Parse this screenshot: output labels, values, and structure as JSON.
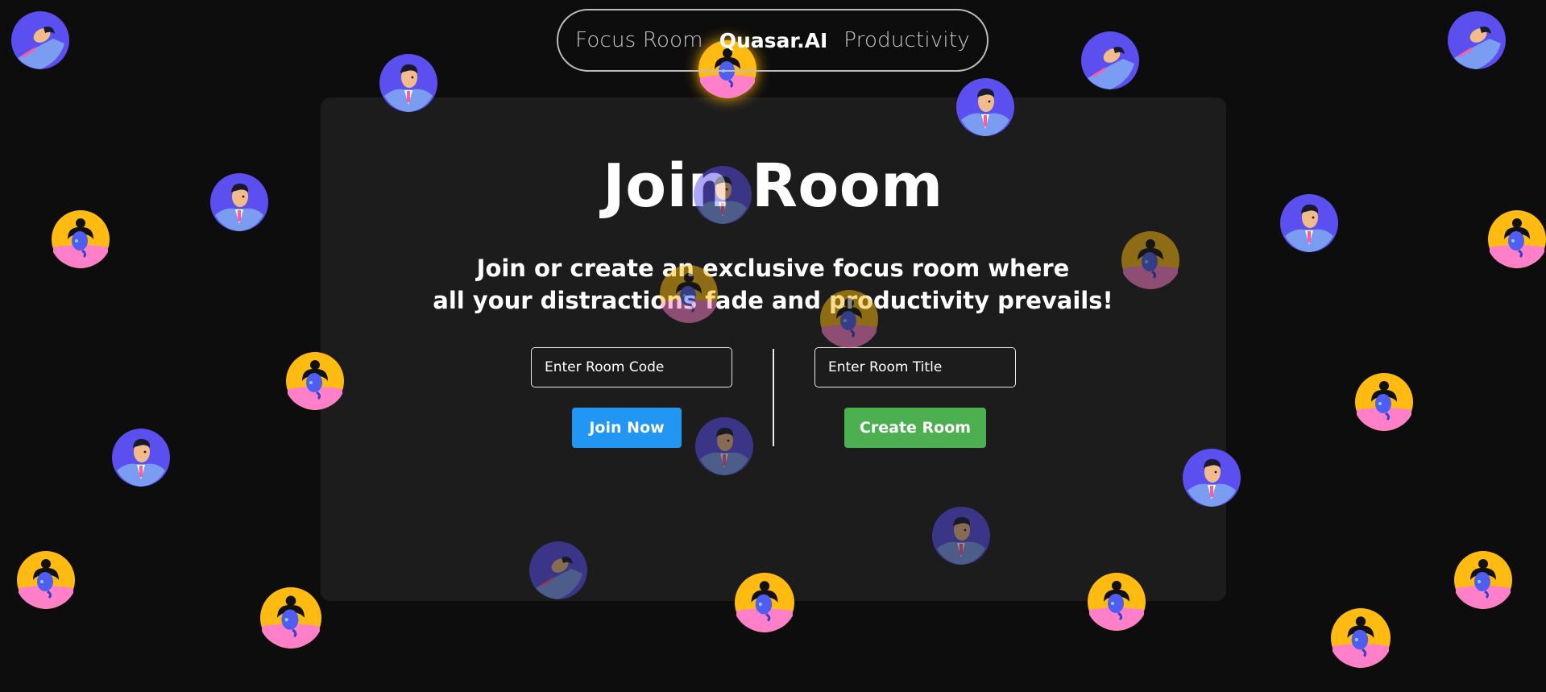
{
  "nav": {
    "left_label": "Focus Room",
    "brand": "Quasar.AI",
    "right_label": "Productivity"
  },
  "main": {
    "title": "Join Room",
    "subtitle_line1": "Join or create an exclusive focus room where",
    "subtitle_line2": "all your distractions fade and productivity prevails!",
    "room_code_placeholder": "Enter Room Code",
    "room_title_placeholder": "Enter Room Title",
    "join_label": "Join Now",
    "create_label": "Create Room"
  },
  "colors": {
    "background": "#0d0d0e",
    "panel": "#1c1c1d",
    "join_button": "#2196f3",
    "create_button": "#4caf50",
    "avatar_blue": "#5b4ff0",
    "avatar_yellow": "#ffbb11",
    "avatar_pink": "#ff80c8"
  },
  "avatar_icons": [
    "man-avatar-icon",
    "woman-avatar-icon",
    "sleeping-avatar-icon"
  ]
}
